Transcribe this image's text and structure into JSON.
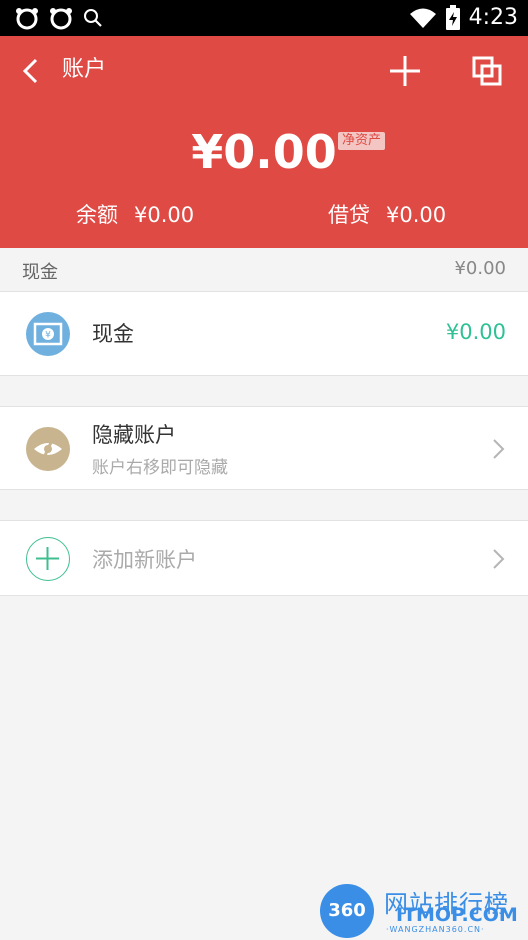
{
  "status_bar": {
    "time": "4:23"
  },
  "header": {
    "title": "账户",
    "net_amount": "¥0.00",
    "net_badge": "净资产",
    "balance_label": "余额",
    "balance_value": "¥0.00",
    "loan_label": "借贷",
    "loan_value": "¥0.00",
    "background_color": "#df4a44"
  },
  "section": {
    "title": "现金",
    "total": "¥0.00"
  },
  "accounts": [
    {
      "name": "现金",
      "value": "¥0.00",
      "icon": "cash-icon",
      "value_color": "#2fc195"
    }
  ],
  "hidden_accounts": {
    "title": "隐藏账户",
    "subtitle": "账户右移即可隐藏",
    "icon": "eye-slash-icon"
  },
  "add_account": {
    "label": "添加新账户",
    "icon": "plus-circle-icon"
  },
  "watermark": {
    "badge": "360",
    "title": "网站排行榜",
    "domain": "ITMOP.COM",
    "small": "·WANGZHAN360.CN·"
  }
}
